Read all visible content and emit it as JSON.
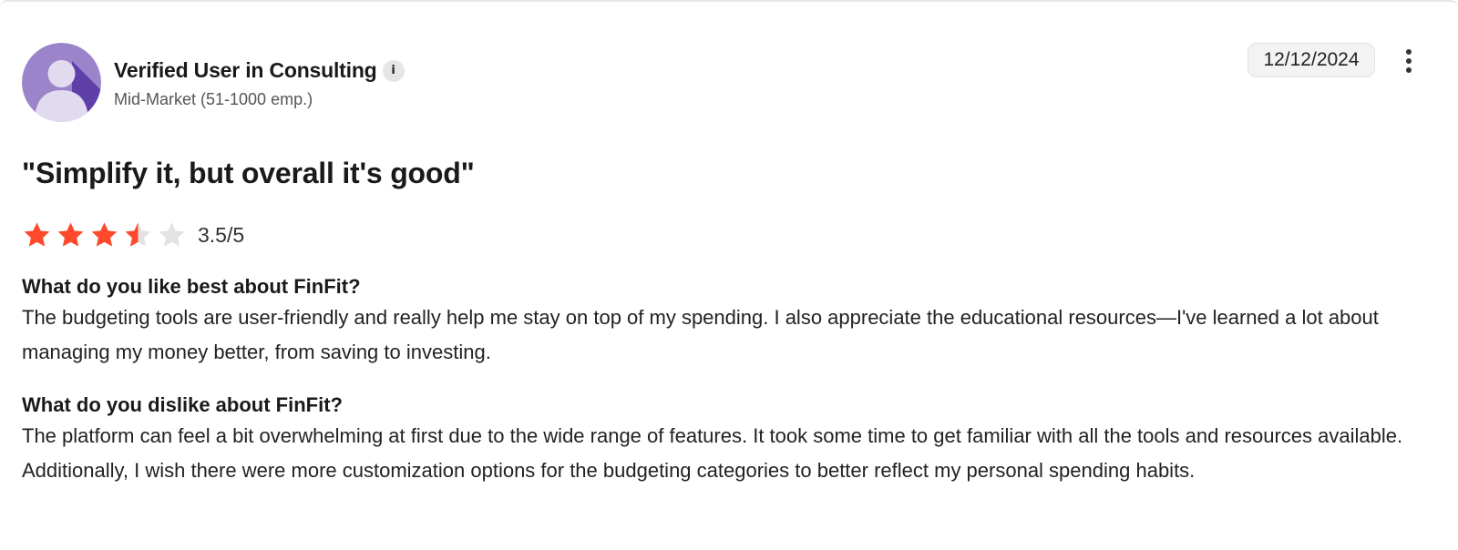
{
  "reviewer": {
    "name": "Verified User in Consulting",
    "info_icon": "i",
    "segment": "Mid-Market (51-1000 emp.)",
    "avatar_icon": "user-avatar-icon"
  },
  "date": "12/12/2024",
  "menu_icon": "more-vertical-icon",
  "review": {
    "title": "\"Simplify it, but overall it's good\"",
    "rating": 3.5,
    "rating_max": 5,
    "rating_text": "3.5/5",
    "star_color": "#ff492c",
    "empty_star_color": "#e3e3e3",
    "questions": [
      {
        "question": "What do you like best about FinFit?",
        "answer": "The budgeting tools are user-friendly and really help me stay on top of my spending. I also appreciate the educational resources—I've learned a lot about managing my money better, from saving to investing."
      },
      {
        "question": "What do you dislike about FinFit?",
        "answer": "The platform can feel a bit overwhelming at first due to the wide range of features. It took some time to get familiar with all the tools and resources available. Additionally, I wish there were more customization options for the budgeting categories to better reflect my personal spending habits."
      }
    ]
  }
}
